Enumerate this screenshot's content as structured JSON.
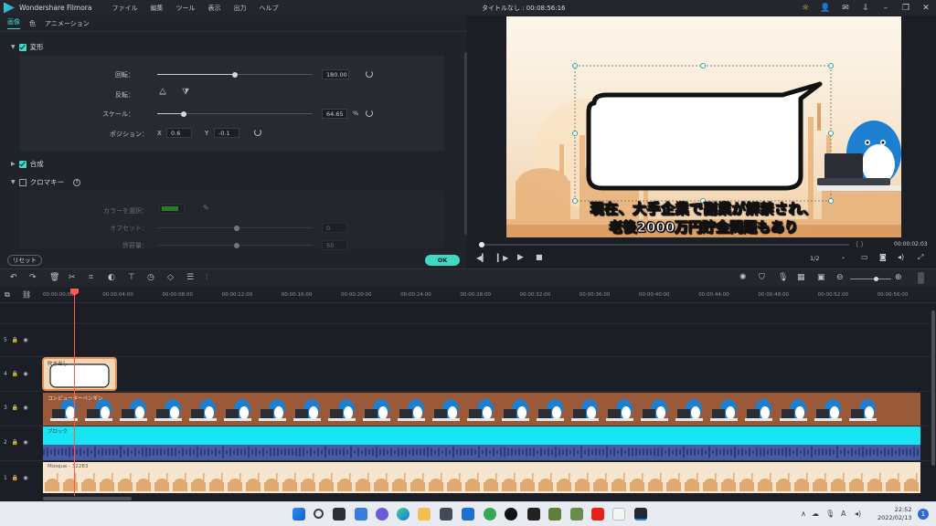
{
  "titlebar": {
    "app_name": "Wondershare Filmora",
    "menu": [
      "ファイル",
      "編集",
      "ツール",
      "表示",
      "出力",
      "ヘルプ"
    ],
    "window_title": "タイトルなし : 00:08:56:16"
  },
  "panel": {
    "tabs": [
      "画像",
      "色",
      "アニメーション"
    ],
    "transform": {
      "label": "変形",
      "rotate_label": "回転：",
      "rotate_value": "180.00",
      "rotate_fraction": 0.5,
      "flip_label": "反転：",
      "scale_label": "スケール：",
      "scale_value": "64.65",
      "scale_unit": "%",
      "scale_fraction": 0.17,
      "position_label": "ポジション：",
      "pos_x_label": "X",
      "pos_x_value": "0.6",
      "pos_y_label": "Y",
      "pos_y_value": "-0.1"
    },
    "composite": {
      "label": "合成"
    },
    "chroma": {
      "label": "クロマキー",
      "color_label": "カラーを選択：",
      "color": "#2cf220",
      "offset_label": "オフセット：",
      "offset_value": "0",
      "tolerance_label": "許容量：",
      "tolerance_value": "50"
    },
    "reset_label": "リセット",
    "ok_label": "OK"
  },
  "preview": {
    "subtitle_line1": "現在、大手企業で副業が解禁され、",
    "subtitle_line2": "老後2000万円貯金問題もあり",
    "timecode": "00:00:02:03",
    "quality": "1/2"
  },
  "ruler": {
    "ticks": [
      "00:00:00:00",
      "00:00:04:00",
      "00:00:08:00",
      "00:00:12:00",
      "00:00:16:00",
      "00:00:20:00",
      "00:00:24:00",
      "00:00:28:00",
      "00:00:32:00",
      "00:00:36:00",
      "00:00:40:00",
      "00:00:44:00",
      "00:00:48:00",
      "00:00:52:00",
      "00:00:56:00"
    ]
  },
  "tracks": {
    "labels": [
      "5",
      "4",
      "3",
      "2",
      "1"
    ],
    "clip_bubble": "吹き出し",
    "clip_penguin": "コンピューターペンギン",
    "clip_cyan": "ブロック",
    "clip_mosque": "Mosque - 32283"
  },
  "taskbar": {
    "time": "22:52",
    "date": "2022/02/13",
    "notifications": "1",
    "ime": "A"
  }
}
